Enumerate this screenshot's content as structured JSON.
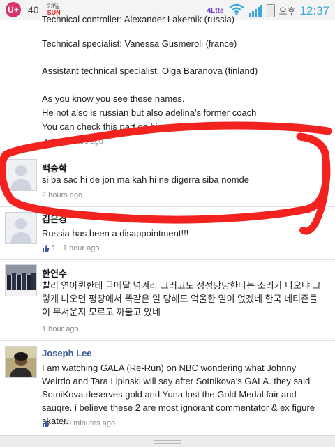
{
  "status_bar": {
    "carrier_logo": "U+",
    "temperature": "40",
    "date_day": "23일",
    "date_weekday": "SUN",
    "network_label": "4Ltte",
    "ampm": "오후",
    "time": "12:37",
    "icons": [
      "wifi-icon",
      "signal-icon",
      "battery-icon"
    ]
  },
  "previous_post": {
    "top_partial": "Technical controller: Alexander Lakernik (russia)",
    "line1": "Technical specialist: Vanessa Gusmeroli (france)",
    "line2": "Assistant technical specialist: Olga Baranova (finland)",
    "line3": "As you know you see these names.",
    "line4": "He not also is russian but also adelina's former coach",
    "line5": "You can check this part on his profile.",
    "likes": "1",
    "time": "· 2 hours ago"
  },
  "comments": [
    {
      "name": "백승학",
      "text": "si ba sac hi de jon ma kah hi ne digerra siba nomde",
      "time": "2 hours ago"
    },
    {
      "name": "김은경",
      "text": "Russia has been a disappointment!!!",
      "likes": "1",
      "time": "· 1 hour ago"
    },
    {
      "name": "한연수",
      "text": "빨리 연아퀸한테 금메달 넘겨라 그러고도 정정당당한다는 소리가 나오냐 그렇게 나오면 평창에서 똑같은 일 당해도 억울한 일이 없겠네 한국 네티즌들이 무서운지 모르고 까불고 있네",
      "time": "1 hour ago"
    },
    {
      "name": "Joseph Lee",
      "text": "I am watching GALA (Re-Run) on NBC wondering what Johnny Weirdo and Tara Lipinski will say after Sotnikova's GALA. they said SotniKova deserves gold and Yuna lost the Gold Medal fair and sauqre. i believe these 2 are most ignorant commentator & ex figure skater.",
      "likes": "1",
      "time": "· 39 minutes ago"
    }
  ],
  "colors": {
    "link_blue": "#3b5998",
    "meta_gray": "#8a8a8a",
    "scribble_red": "#f2221f",
    "clock_blue": "#3aa9d8"
  }
}
